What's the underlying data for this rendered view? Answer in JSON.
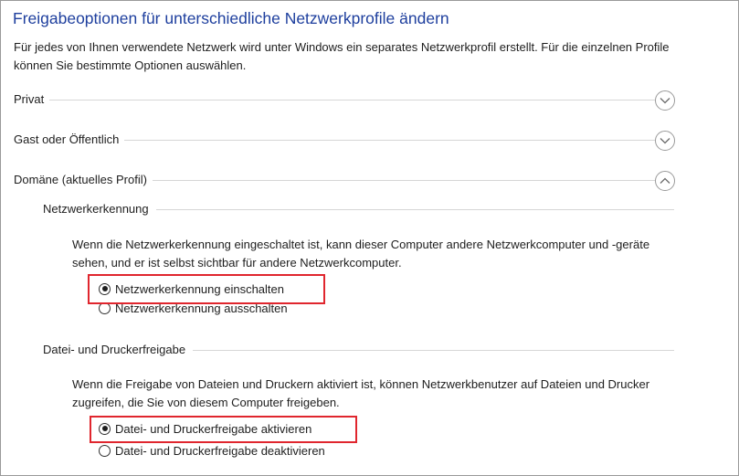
{
  "page": {
    "title": "Freigabeoptionen für unterschiedliche Netzwerkprofile ändern",
    "description": "Für jedes von Ihnen verwendete Netzwerk wird unter Windows ein separates Netzwerkprofil erstellt. Für die einzelnen Profile können Sie bestimmte Optionen auswählen."
  },
  "profiles": [
    {
      "label": "Privat",
      "expanded": false,
      "toggle_icon": "chevron-down-icon"
    },
    {
      "label": "Gast oder Öffentlich",
      "expanded": false,
      "toggle_icon": "chevron-down-icon"
    },
    {
      "label": "Domäne (aktuelles Profil)",
      "expanded": true,
      "toggle_icon": "chevron-up-icon"
    }
  ],
  "network_discovery": {
    "heading": "Netzwerkerkennung",
    "text": "Wenn die Netzwerkerkennung eingeschaltet ist, kann dieser Computer andere Netzwerkcomputer und -geräte sehen, und er ist selbst sichtbar für andere Netzwerkcomputer.",
    "option_on": "Netzwerkerkennung einschalten",
    "option_off": "Netzwerkerkennung ausschalten",
    "selected": "on"
  },
  "file_printer_sharing": {
    "heading": "Datei- und Druckerfreigabe",
    "text": "Wenn die Freigabe von Dateien und Druckern aktiviert ist, können Netzwerkbenutzer auf Dateien und Drucker zugreifen, die Sie von diesem Computer freigeben.",
    "option_on": "Datei- und Druckerfreigabe aktivieren",
    "option_off": "Datei- und Druckerfreigabe deaktivieren",
    "selected": "on"
  },
  "colors": {
    "title": "#1e3f9e",
    "highlight": "#e0262e"
  }
}
